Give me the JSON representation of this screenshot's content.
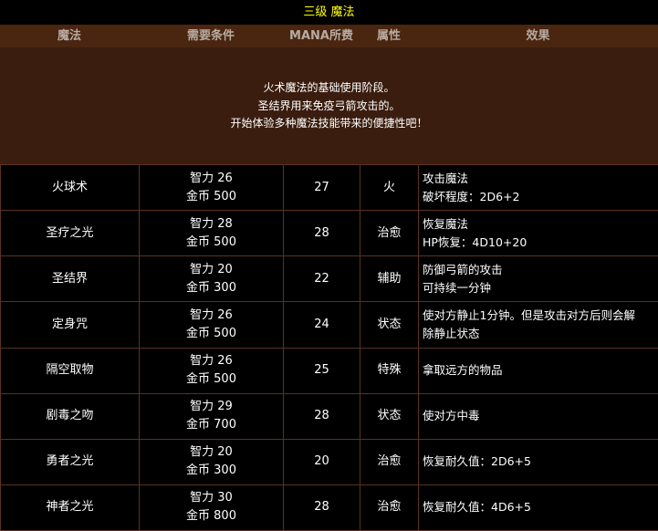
{
  "title": "三级 魔法",
  "headers": {
    "magic": "魔法",
    "requirements": "需要条件",
    "mana": "MANA所费",
    "attribute": "属性",
    "effect": "效果"
  },
  "intro": [
    "火术魔法的基础使用阶段。",
    "圣结界用来免疫弓箭攻击的。",
    "开始体验多种魔法技能带来的便捷性吧！"
  ],
  "spells": [
    {
      "name": "火球术",
      "req_int": "智力 26",
      "req_gold": "金币 500",
      "mana": "27",
      "attr": "火",
      "effect1": "攻击魔法",
      "effect2": "破坏程度：2D6+2"
    },
    {
      "name": "圣疗之光",
      "req_int": "智力 28",
      "req_gold": "金币 500",
      "mana": "28",
      "attr": "治愈",
      "effect1": "恢复魔法",
      "effect2": "HP恢复：4D10+20"
    },
    {
      "name": "圣结界",
      "req_int": "智力 20",
      "req_gold": "金币 300",
      "mana": "22",
      "attr": "辅助",
      "effect1": "防御弓箭的攻击",
      "effect2": "可持续一分钟"
    },
    {
      "name": "定身咒",
      "req_int": "智力 26",
      "req_gold": "金币 500",
      "mana": "24",
      "attr": "状态",
      "effect1": "使对方静止1分钟。但是攻击对方后则会解",
      "effect2": "除静止状态"
    },
    {
      "name": "隔空取物",
      "req_int": "智力 26",
      "req_gold": "金币 500",
      "mana": "25",
      "attr": "特殊",
      "effect1": "拿取远方的物品",
      "effect2": ""
    },
    {
      "name": "剧毒之吻",
      "req_int": "智力 29",
      "req_gold": "金币 700",
      "mana": "28",
      "attr": "状态",
      "effect1": "使对方中毒",
      "effect2": ""
    },
    {
      "name": "勇者之光",
      "req_int": "智力 20",
      "req_gold": "金币 300",
      "mana": "20",
      "attr": "治愈",
      "effect1": "恢复耐久值：2D6+5",
      "effect2": ""
    },
    {
      "name": "神者之光",
      "req_int": "智力 30",
      "req_gold": "金币 800",
      "mana": "28",
      "attr": "治愈",
      "effect1": "恢复耐久值：4D6+5",
      "effect2": ""
    }
  ]
}
